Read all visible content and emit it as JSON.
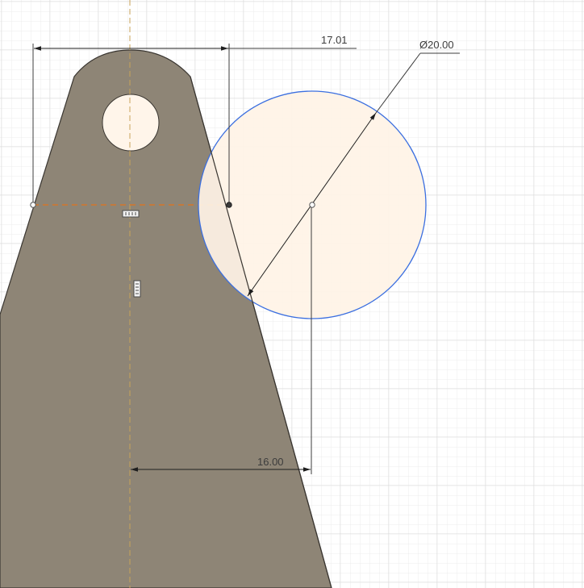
{
  "sketch": {
    "dimensions": {
      "top_width": "17.01",
      "circle_diameter": "Ø20.00",
      "circle_offset": "16.00"
    },
    "colors": {
      "background": "#ffffff",
      "grid_minor": "#ececec",
      "grid_major": "#dcdcdc",
      "body_fill": "#8e8576",
      "body_edge": "#3a3631",
      "hole_fill": "#fff5ea",
      "circle_fill": "#fff3e6",
      "circle_stroke": "#3b6fe0",
      "dimension_line": "#3c3c3c",
      "construction_line": "#c8a35a",
      "construction_dashed": "#d2762b",
      "constraint_icon": "#4a4a4a"
    },
    "icons": {
      "horizontal_constraint": "horizontal-constraint-icon",
      "vertical_constraint": "vertical-constraint-icon"
    }
  }
}
